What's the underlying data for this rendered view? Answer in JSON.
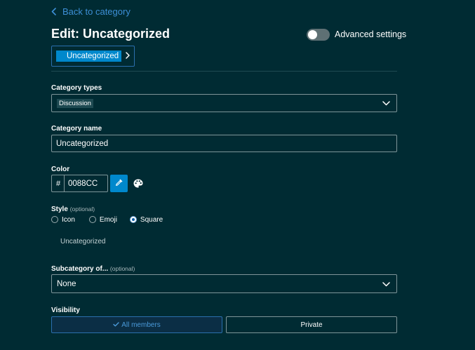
{
  "nav": {
    "back_label": "Back to category"
  },
  "header": {
    "title": "Edit: Uncategorized",
    "advanced_label": "Advanced settings",
    "advanced_enabled": false
  },
  "breadcrumb": {
    "category": "Uncategorized",
    "badge_color": "#0088CC"
  },
  "category_types": {
    "label": "Category types",
    "selected": "Discussion"
  },
  "category_name": {
    "label": "Category name",
    "value": "Uncategorized"
  },
  "color": {
    "label": "Color",
    "prefix": "#",
    "value": "0088CC"
  },
  "style": {
    "label": "Style",
    "optional": "(optional)",
    "options": [
      {
        "label": "Icon",
        "checked": false
      },
      {
        "label": "Emoji",
        "checked": false
      },
      {
        "label": "Square",
        "checked": true
      }
    ],
    "preview": "Uncategorized"
  },
  "subcategory": {
    "label": "Subcategory of...",
    "optional": "(optional)",
    "selected": "None"
  },
  "visibility": {
    "label": "Visibility",
    "options": [
      {
        "label": "All members",
        "active": true
      },
      {
        "label": "Private",
        "active": false
      }
    ]
  },
  "icons": [
    "chevron-left-icon",
    "chevron-right-icon",
    "chevron-down-icon",
    "eyedropper-icon",
    "palette-icon",
    "check-icon"
  ],
  "colors": {
    "background": "#002B33",
    "accent": "#0088CC",
    "link": "#3D8FD6"
  }
}
